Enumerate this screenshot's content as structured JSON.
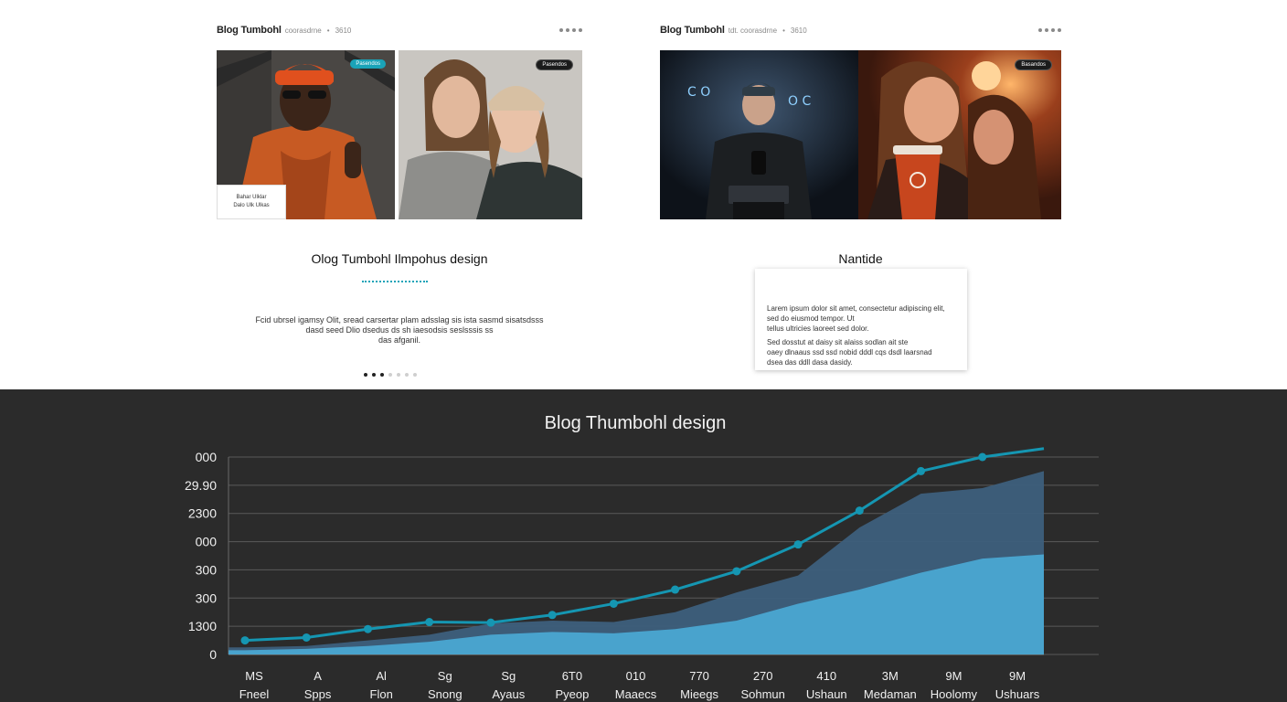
{
  "cards": [
    {
      "title": "Blog Tumbohl",
      "meta": "coorasdrne",
      "year": "3610",
      "badges": [
        "Pasendos",
        "Pasendos"
      ],
      "thumb_label": [
        "Bahar Ulklar",
        "Dalo Ulk Ulkas"
      ],
      "section_title": "Olog Tumbohl Ilmpohus design",
      "body": [
        "Fcid ubrsel igamsy Olit, sread carsertar plam adsslag sis ista sasmd sisatsdsss",
        "dasd seed Dlio dsedus ds sh iaesodsis seslsssis ss",
        "das afganil."
      ]
    },
    {
      "title": "Blog Tumbohl",
      "meta": "tdt. coorasdrne",
      "year": "3610",
      "badges": [
        "Basandos"
      ],
      "section_title": "Nantide",
      "body": [
        "Larem ipsum dolor sit amet, consectetur adipiscing elit, sed do eiusmod tempor. Ut",
        "tellus ultricies laoreet sed dolor.",
        "Sed dosstut at daisy sit alaiss sodlan ait ste",
        "oaey dlnaaus ssd ssd nobid dddl cqs dsdl laarsnad",
        "dsea das ddll dasa dasidy."
      ]
    }
  ],
  "pager": {
    "total": 7,
    "active": [
      0,
      1,
      2
    ]
  },
  "colors": {
    "accent": "#1aa3b8",
    "line": "#1596b2",
    "area_dark": "#3d5f7c",
    "area_light": "#4aa6d2",
    "bg_dark": "#2b2b2b"
  },
  "chart_data": {
    "type": "area",
    "title": "Blog Thumbohl design",
    "y_ticks": [
      "000",
      "29.90",
      "2300",
      "000",
      "300",
      "300",
      "1300",
      "0"
    ],
    "x_ticks_top": [
      "MS",
      "A",
      "Al",
      "Sg",
      "Sg",
      "6T0",
      "010",
      "770",
      "270",
      "410",
      "3M",
      "9M",
      "9M"
    ],
    "x_ticks_bottom": [
      "Fneel",
      "Spps",
      "Flon",
      "Snong",
      "Ayaus",
      "Pyeop",
      "Maaecs",
      "Mieegs",
      "Sohmun",
      "Ushaun",
      "Medaman",
      "Hoolomy",
      "Ushuars"
    ],
    "ylim": [
      0,
      7
    ],
    "series": [
      {
        "values": [
          0.5,
          0.6,
          0.9,
          1.15,
          1.13,
          1.4,
          1.8,
          2.3,
          2.95,
          3.9,
          5.1,
          6.5,
          7.0,
          7.3
        ]
      },
      {
        "values": [
          0.25,
          0.3,
          0.5,
          0.7,
          1.1,
          1.2,
          1.15,
          1.5,
          2.2,
          2.8,
          4.5,
          5.7,
          5.9,
          6.5
        ]
      },
      {
        "values": [
          0.15,
          0.2,
          0.3,
          0.45,
          0.7,
          0.8,
          0.75,
          0.9,
          1.2,
          1.8,
          2.3,
          2.9,
          3.4,
          3.55
        ]
      }
    ]
  }
}
